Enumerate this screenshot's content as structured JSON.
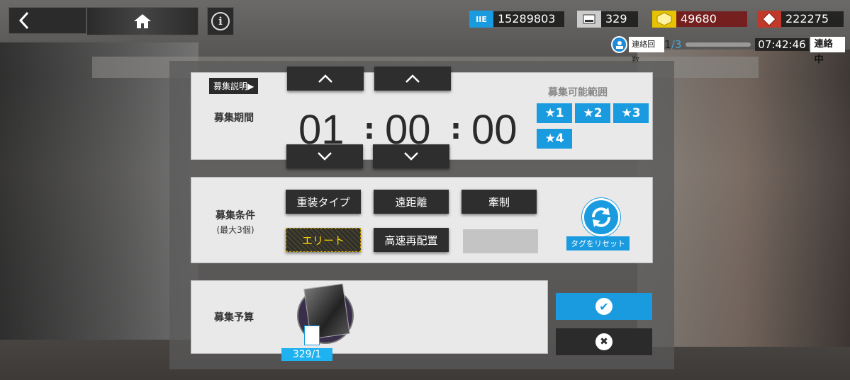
{
  "topbar": {
    "back_icon": "chevron-left-icon",
    "home_icon": "home-icon",
    "info_icon": "info-icon",
    "info_glyph": "i"
  },
  "resources": [
    {
      "icon_text": "IIE",
      "value": "15289803",
      "color": "#1a9be0"
    },
    {
      "icon_text": "",
      "value": "329",
      "color": "#dddddd"
    },
    {
      "icon_text": "",
      "value": "49680",
      "color": "#e6c200"
    },
    {
      "icon_text": "",
      "value": "222275",
      "color": "#c0392b"
    }
  ],
  "contact": {
    "label": "連絡回数",
    "count": "1",
    "total": "/3",
    "time": "07:42:46",
    "state": "連絡中"
  },
  "recruit_time": {
    "info_tag": "募集説明▶",
    "label": "募集期間",
    "hours": "01",
    "minutes": "00",
    "seconds": "00",
    "colon": ":",
    "range_title": "募集可能範囲",
    "stars": [
      "★1",
      "★2",
      "★3",
      "★4"
    ]
  },
  "recruit_tags": {
    "label": "募集条件",
    "sublabel": "(最大3個)",
    "tags": [
      "重装タイプ",
      "遠距離",
      "牽制",
      "エリート",
      "高速再配置",
      ""
    ],
    "reset_label": "タグをリセット"
  },
  "recruit_budget": {
    "label": "募集予算",
    "count": "329/1"
  },
  "colors": {
    "accent": "#1a9be0",
    "dark_button": "#2e2e2e",
    "elite_text": "#ffd800"
  }
}
